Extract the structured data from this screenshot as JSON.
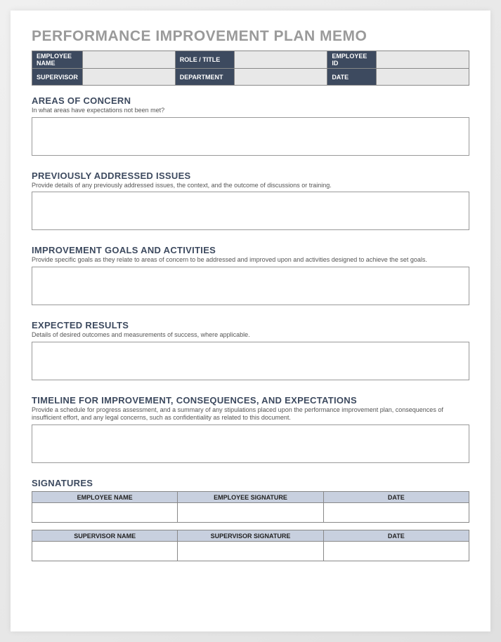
{
  "title": "PERFORMANCE IMPROVEMENT PLAN MEMO",
  "info": {
    "row1": {
      "label1": "EMPLOYEE NAME",
      "value1": "",
      "label2": "ROLE / TITLE",
      "value2": "",
      "label3": "EMPLOYEE ID",
      "value3": ""
    },
    "row2": {
      "label1": "SUPERVISOR",
      "value1": "",
      "label2": "DEPARTMENT",
      "value2": "",
      "label3": "DATE",
      "value3": ""
    }
  },
  "sections": {
    "areas": {
      "heading": "AREAS OF CONCERN",
      "hint": "In what areas have expectations not been met?",
      "value": ""
    },
    "previous": {
      "heading": "PREVIOUSLY ADDRESSED ISSUES",
      "hint": "Provide details of any previously addressed issues, the context, and the outcome of discussions or training.",
      "value": ""
    },
    "goals": {
      "heading": "IMPROVEMENT GOALS AND ACTIVITIES",
      "hint": "Provide specific goals as they relate to areas of concern to be addressed and improved upon and activities designed to achieve the set goals.",
      "value": ""
    },
    "results": {
      "heading": "EXPECTED RESULTS",
      "hint": "Details of desired outcomes and measurements of success, where applicable.",
      "value": ""
    },
    "timeline": {
      "heading": "TIMELINE FOR IMPROVEMENT, CONSEQUENCES, AND EXPECTATIONS",
      "hint": "Provide a schedule for progress assessment, and a summary of any stipulations placed upon the performance improvement plan, consequences of insufficient effort, and any legal concerns, such as confidentiality as related to this document.",
      "value": ""
    }
  },
  "signatures": {
    "heading": "SIGNATURES",
    "employee": {
      "col1": "EMPLOYEE NAME",
      "col2": "EMPLOYEE SIGNATURE",
      "col3": "DATE"
    },
    "supervisor": {
      "col1": "SUPERVISOR NAME",
      "col2": "SUPERVISOR SIGNATURE",
      "col3": "DATE"
    }
  }
}
